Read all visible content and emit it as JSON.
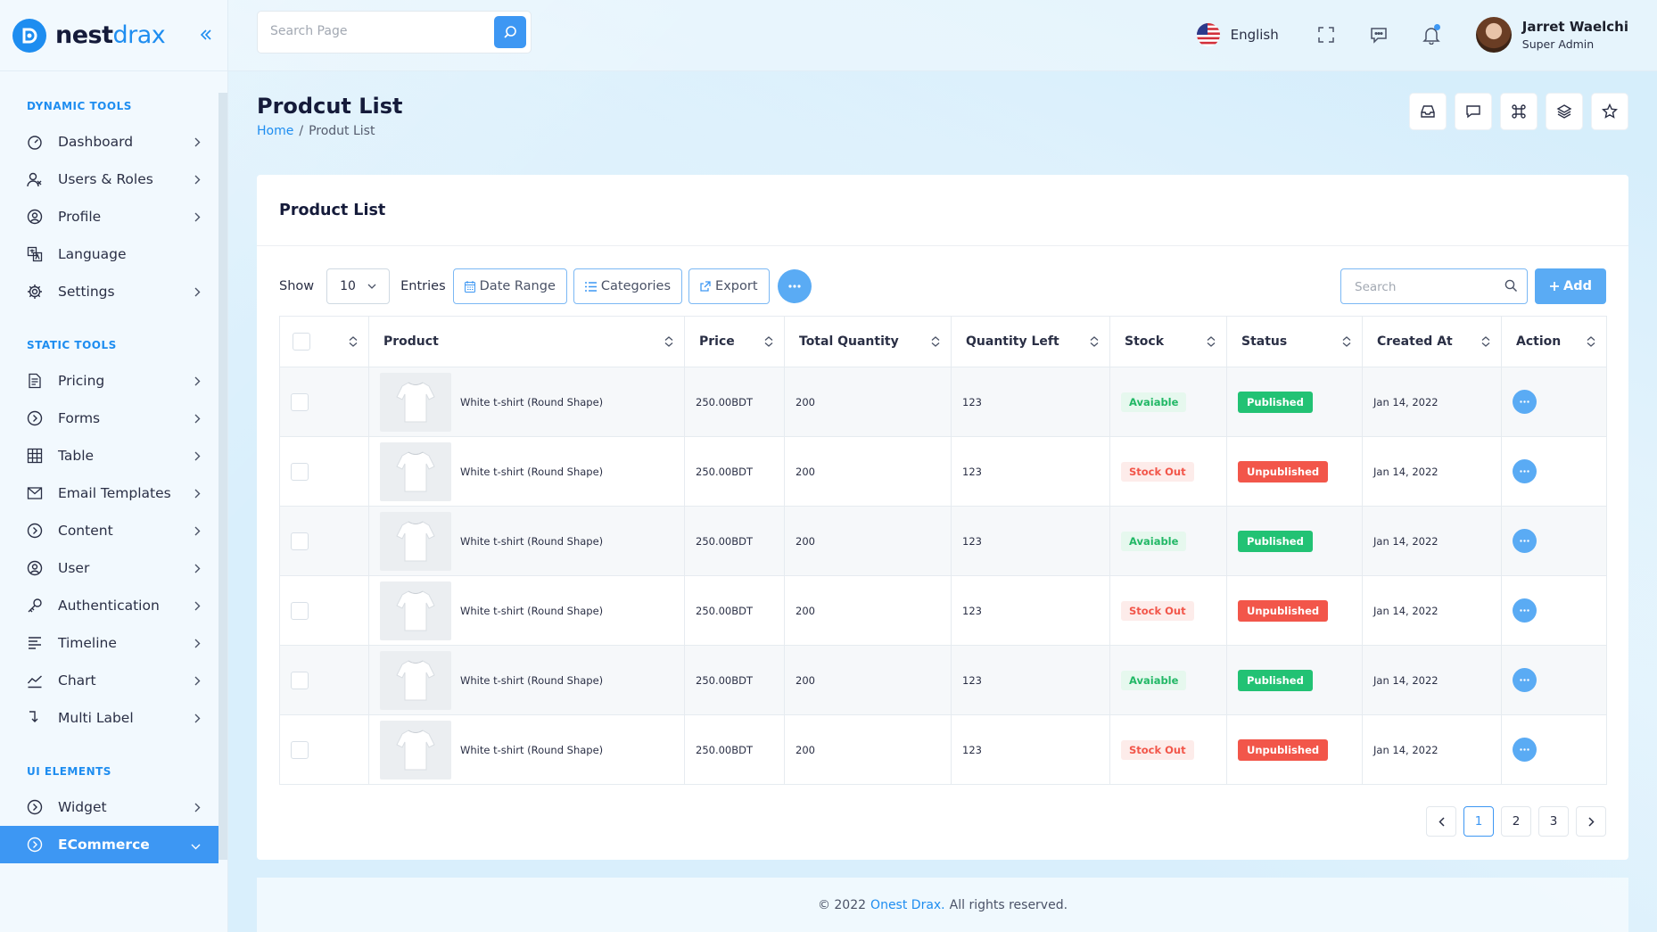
{
  "brand": {
    "name_part1": "nest",
    "name_part2": "drax"
  },
  "header": {
    "search_placeholder": "Search Page",
    "language": "English",
    "user_name": "Jarret Waelchi",
    "user_role": "Super Admin"
  },
  "sidebar": {
    "sections": {
      "dynamic": "DYNAMIC TOOLS",
      "static": "STATIC TOOLS",
      "ui": "UI ELEMENTS"
    },
    "dynamic_items": [
      "Dashboard",
      "Users & Roles",
      "Profile",
      "Language",
      "Settings"
    ],
    "static_items": [
      "Pricing",
      "Forms",
      "Table",
      "Email Templates",
      "Content",
      "User",
      "Authentication",
      "Timeline",
      "Chart",
      "Multi Label"
    ],
    "ui_items": [
      "Widget",
      "ECommerce"
    ]
  },
  "page": {
    "title": "Prodcut List",
    "breadcrumb_home": "Home",
    "breadcrumb_sep": "/",
    "breadcrumb_current": "Produt List"
  },
  "card": {
    "title": "Product List",
    "show_label": "Show",
    "entries_value": "10",
    "entries_label": "Entries",
    "date_range": "Date Range",
    "categories": "Categories",
    "export": "Export",
    "search_placeholder": "Search",
    "add": "Add"
  },
  "table": {
    "columns": [
      "Product",
      "Price",
      "Total Quantity",
      "Quantity Left",
      "Stock",
      "Status",
      "Created At",
      "Action"
    ],
    "rows": [
      {
        "product": "White t-shirt (Round Shape)",
        "price": "250.00BDT",
        "total": "200",
        "left": "123",
        "stock": "Avaiable",
        "status": "Published",
        "created": "Jan 14, 2022"
      },
      {
        "product": "White t-shirt (Round Shape)",
        "price": "250.00BDT",
        "total": "200",
        "left": "123",
        "stock": "Stock Out",
        "status": "Unpublished",
        "created": "Jan 14, 2022"
      },
      {
        "product": "White t-shirt (Round Shape)",
        "price": "250.00BDT",
        "total": "200",
        "left": "123",
        "stock": "Avaiable",
        "status": "Published",
        "created": "Jan 14, 2022"
      },
      {
        "product": "White t-shirt (Round Shape)",
        "price": "250.00BDT",
        "total": "200",
        "left": "123",
        "stock": "Stock Out",
        "status": "Unpublished",
        "created": "Jan 14, 2022"
      },
      {
        "product": "White t-shirt (Round Shape)",
        "price": "250.00BDT",
        "total": "200",
        "left": "123",
        "stock": "Avaiable",
        "status": "Published",
        "created": "Jan 14, 2022"
      },
      {
        "product": "White t-shirt (Round Shape)",
        "price": "250.00BDT",
        "total": "200",
        "left": "123",
        "stock": "Stock Out",
        "status": "Unpublished",
        "created": "Jan 14, 2022"
      }
    ]
  },
  "pagination": {
    "pages": [
      "1",
      "2",
      "3"
    ],
    "current": "1"
  },
  "footer": {
    "prefix": "© 2022",
    "brand": "Onest Drax.",
    "suffix": "All rights reserved."
  },
  "colors": {
    "accent": "#3d97f3",
    "published": "#22c274",
    "unpublished": "#f2564a"
  }
}
